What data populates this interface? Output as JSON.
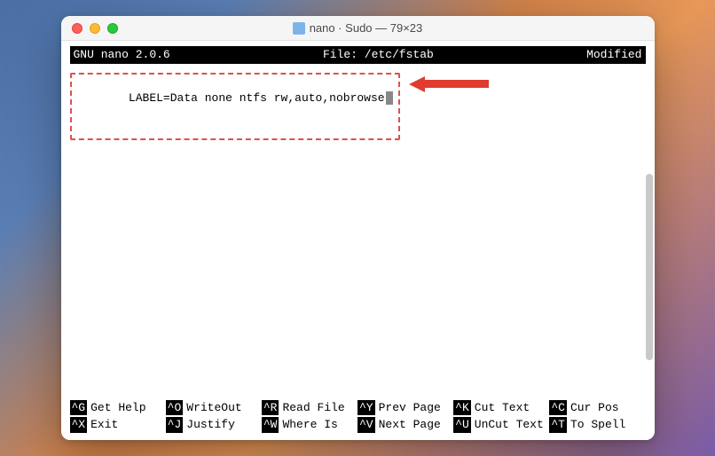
{
  "window": {
    "title": "nano · Sudo — 79×23"
  },
  "header": {
    "app": "GNU nano 2.0.6",
    "file_label": "File: /etc/fstab",
    "status": "Modified"
  },
  "content": {
    "line1": "LABEL=Data none ntfs rw,auto,nobrowse"
  },
  "shortcuts": {
    "row1": [
      {
        "key": "^G",
        "label": "Get Help"
      },
      {
        "key": "^O",
        "label": "WriteOut"
      },
      {
        "key": "^R",
        "label": "Read File"
      },
      {
        "key": "^Y",
        "label": "Prev Page"
      },
      {
        "key": "^K",
        "label": "Cut Text"
      },
      {
        "key": "^C",
        "label": "Cur Pos"
      }
    ],
    "row2": [
      {
        "key": "^X",
        "label": "Exit"
      },
      {
        "key": "^J",
        "label": "Justify"
      },
      {
        "key": "^W",
        "label": "Where Is"
      },
      {
        "key": "^V",
        "label": "Next Page"
      },
      {
        "key": "^U",
        "label": "UnCut Text"
      },
      {
        "key": "^T",
        "label": "To Spell"
      }
    ]
  }
}
